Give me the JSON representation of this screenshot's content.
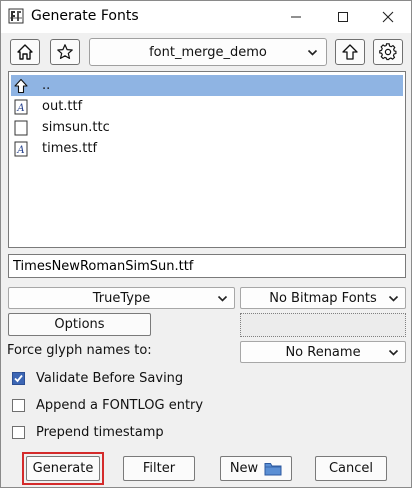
{
  "window": {
    "title": "Generate Fonts",
    "minimize_glyph": "—",
    "maximize_glyph": "☐",
    "close_glyph": "✕"
  },
  "toolbar": {
    "home_icon": "home-icon",
    "bookmark_icon": "star-icon",
    "directory": "font_merge_demo",
    "up_icon": "up-arrow-icon",
    "settings_icon": "gear-icon"
  },
  "file_list": {
    "items": [
      {
        "name": "..",
        "icon": "parent-dir-icon",
        "selected": true
      },
      {
        "name": "out.ttf",
        "icon": "font-file-icon",
        "selected": false
      },
      {
        "name": "simsun.ttc",
        "icon": "blank-file-icon",
        "selected": false
      },
      {
        "name": "times.ttf",
        "icon": "font-file-icon",
        "selected": false
      }
    ]
  },
  "filename_input": {
    "value": "TimesNewRomanSimSun.ttf"
  },
  "format": {
    "outline_type": "TrueType",
    "bitmap_type": "No Bitmap Fonts",
    "options_label": "Options",
    "force_glyph_label": "Force glyph names to:",
    "rename_value": "No Rename"
  },
  "checkboxes": [
    {
      "label": "Validate Before Saving",
      "checked": true
    },
    {
      "label": "Append a FONTLOG entry",
      "checked": false
    },
    {
      "label": "Prepend timestamp",
      "checked": false
    }
  ],
  "buttons": {
    "generate": "Generate",
    "filter": "Filter",
    "new": "New",
    "cancel": "Cancel"
  },
  "colors": {
    "selection": "#8fb4e3",
    "checkbox_accent": "#3c66b4",
    "highlight": "#d42b2b"
  }
}
